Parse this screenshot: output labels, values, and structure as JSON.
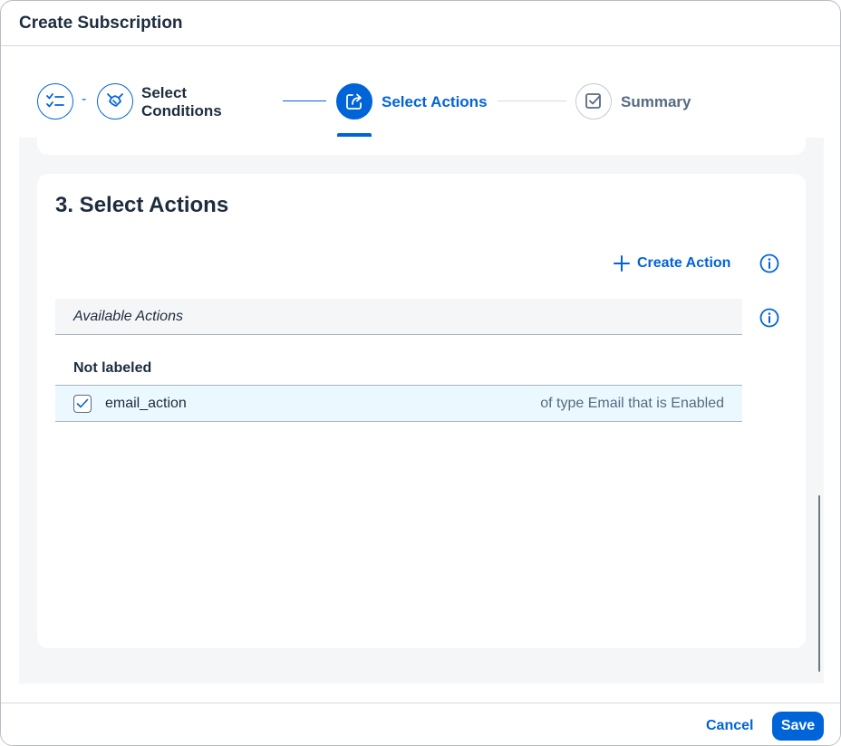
{
  "dialog": {
    "title": "Create Subscription"
  },
  "wizard": {
    "steps": [
      {
        "label": "",
        "icon": "checklist-icon",
        "state": "completed"
      },
      {
        "label": "Select Conditions",
        "line1": "Select",
        "line2": "Conditions",
        "icon": "handshake-icon",
        "state": "completed"
      },
      {
        "label": "Select Actions",
        "icon": "share-arrow-icon",
        "state": "active"
      },
      {
        "label": "Summary",
        "icon": "checkbox-icon",
        "state": "inactive"
      }
    ],
    "separator": "-"
  },
  "section": {
    "title": "3. Select Actions",
    "create_action_label": "Create Action",
    "list_header": "Available Actions",
    "group_label": "Not labeled",
    "rows": [
      {
        "name": "email_action",
        "description": "of type Email that is Enabled",
        "checked": true
      }
    ]
  },
  "footer": {
    "cancel_label": "Cancel",
    "save_label": "Save"
  },
  "colors": {
    "accent": "#0064d9",
    "text": "#1d2d3e",
    "muted": "#556b82",
    "selected_row": "#ebf8ff"
  }
}
